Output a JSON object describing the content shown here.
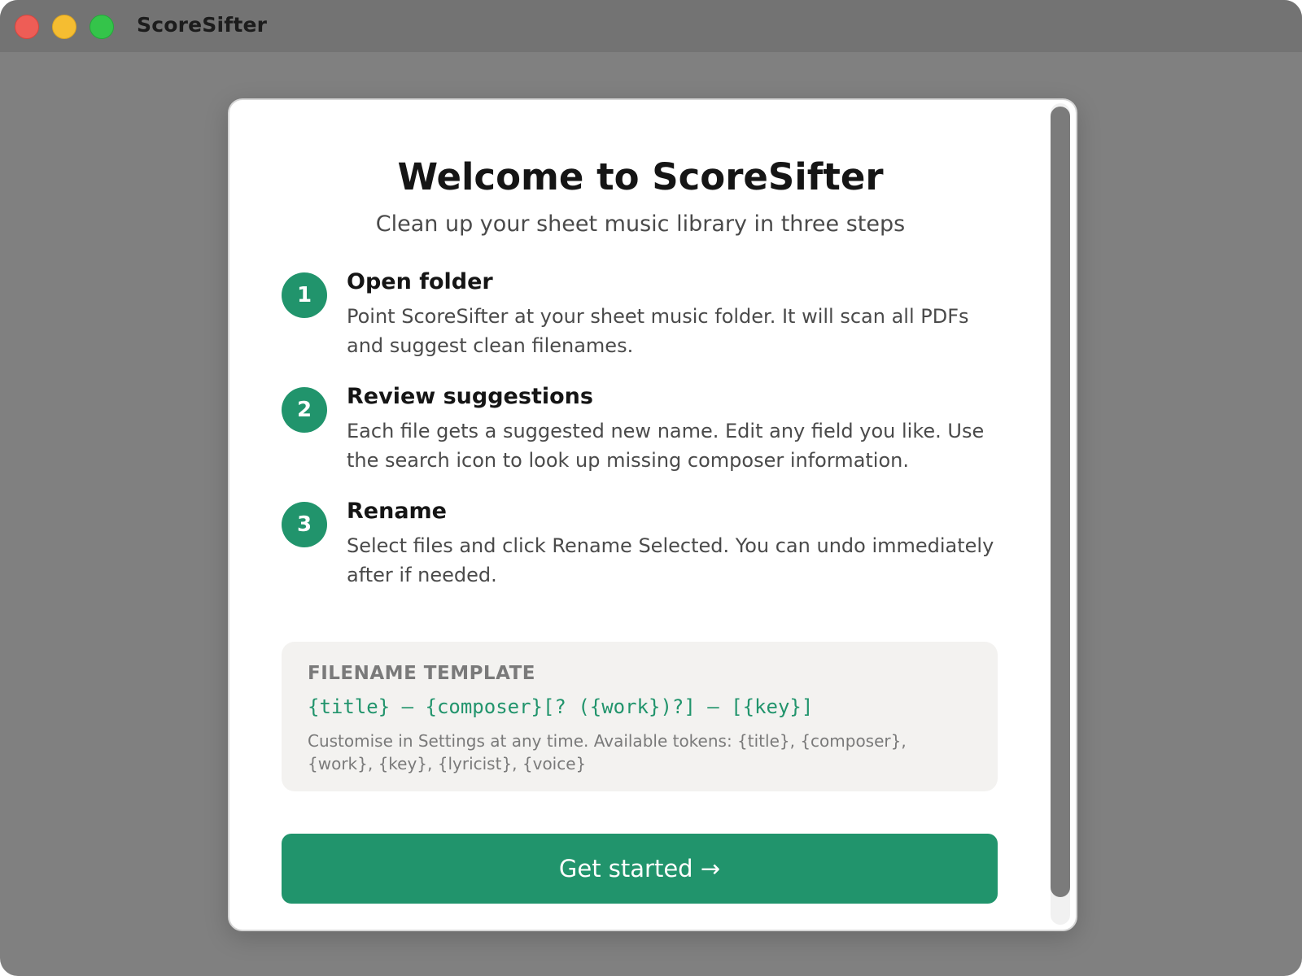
{
  "window": {
    "title": "ScoreSifter"
  },
  "welcome": {
    "title": "Welcome to ScoreSifter",
    "subtitle": "Clean up your sheet music library in three steps"
  },
  "steps": [
    {
      "number": "1",
      "title": "Open folder",
      "description": "Point ScoreSifter at your sheet music folder. It will scan all PDFs and suggest clean filenames."
    },
    {
      "number": "2",
      "title": "Review suggestions",
      "description": "Each file gets a suggested new name. Edit any field you like. Use the search icon to look up missing composer information."
    },
    {
      "number": "3",
      "title": "Rename",
      "description": "Select files and click Rename Selected. You can undo immediately after if needed."
    }
  ],
  "template": {
    "label": "FILENAME TEMPLATE",
    "pattern": "{title} – {composer}[? ({work})?] – [{key}]",
    "note": "Customise in Settings at any time. Available tokens: {title}, {composer}, {work}, {key}, {lyricist}, {voice}"
  },
  "actions": {
    "get_started": "Get started →"
  },
  "colors": {
    "accent": "#21946c",
    "window_bg": "#808080",
    "titlebar_bg": "#737373",
    "card_bg": "#ffffff",
    "template_bg": "#f3f2f0"
  }
}
